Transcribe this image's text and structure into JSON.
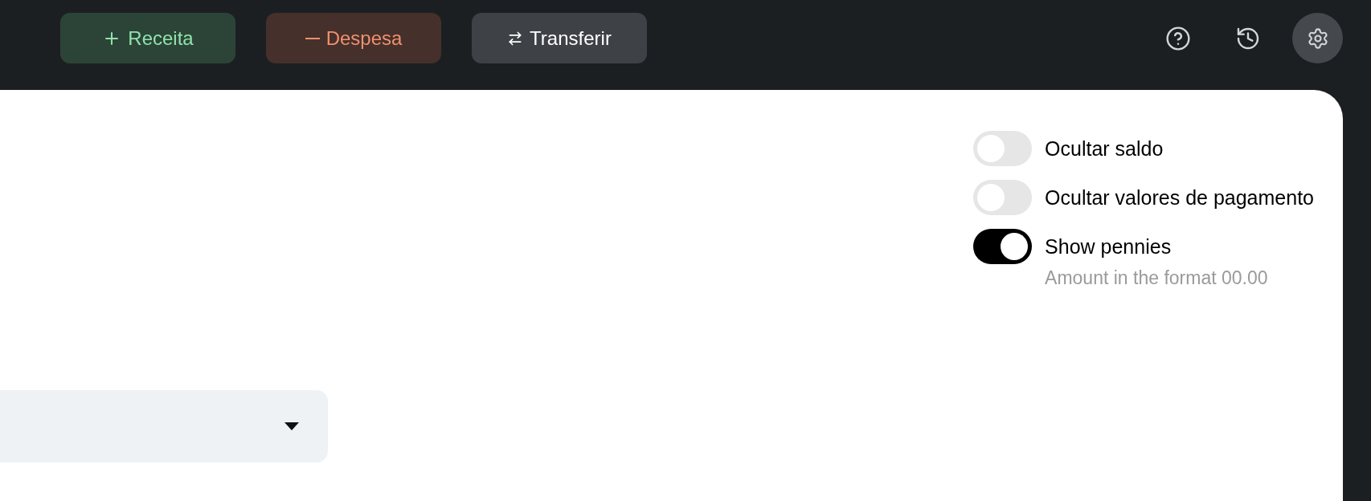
{
  "toolbar": {
    "actions": [
      {
        "kind": "income",
        "label": "Receita"
      },
      {
        "kind": "expense",
        "label": "Despesa"
      },
      {
        "kind": "transfer",
        "label": "Transferir"
      }
    ],
    "icon_buttons": [
      {
        "kind": "help",
        "selected": false
      },
      {
        "kind": "history",
        "selected": false
      },
      {
        "kind": "settings",
        "selected": true
      }
    ]
  },
  "settings": [
    {
      "label": "Ocultar saldo",
      "on": false
    },
    {
      "label": "Ocultar valores de pagamento",
      "on": false
    },
    {
      "label": "Show pennies",
      "on": true,
      "description": "Amount in the format 00.00"
    }
  ]
}
